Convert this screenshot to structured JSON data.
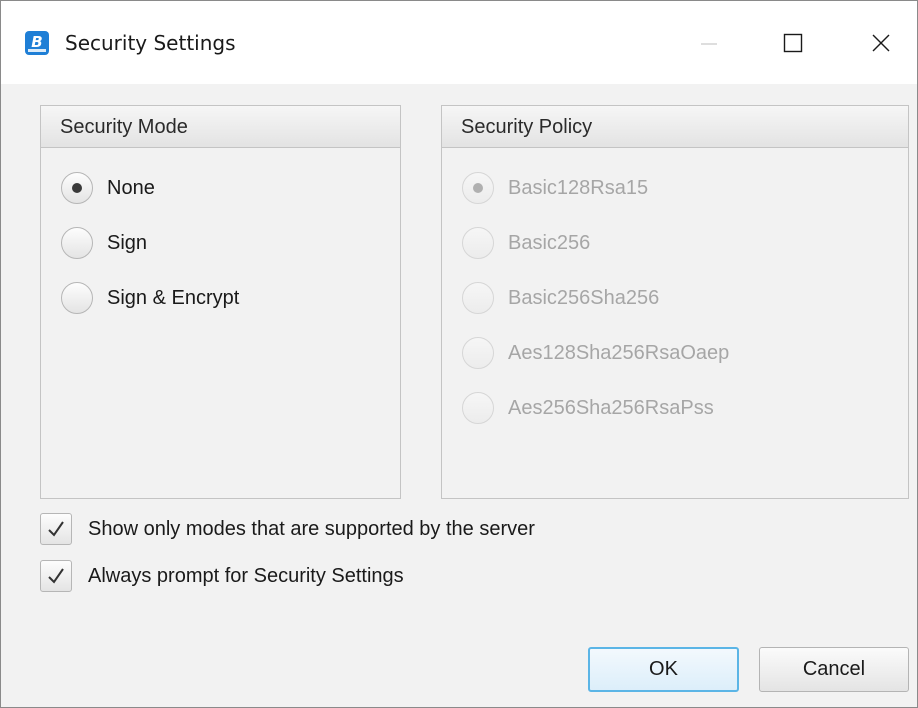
{
  "window": {
    "title": "Security Settings",
    "app_icon_letter": "B",
    "app_icon_color": "#1f7fd6",
    "controls": [
      "minimize-icon",
      "maximize-icon",
      "close-icon"
    ]
  },
  "security_mode": {
    "title": "Security Mode",
    "options": [
      {
        "label": "None",
        "selected": true
      },
      {
        "label": "Sign",
        "selected": false
      },
      {
        "label": "Sign & Encrypt",
        "selected": false
      }
    ]
  },
  "security_policy": {
    "title": "Security Policy",
    "enabled": false,
    "options": [
      {
        "label": "Basic128Rsa15",
        "selected": true
      },
      {
        "label": "Basic256",
        "selected": false
      },
      {
        "label": "Basic256Sha256",
        "selected": false
      },
      {
        "label": "Aes128Sha256RsaOaep",
        "selected": false
      },
      {
        "label": "Aes256Sha256RsaPss",
        "selected": false
      }
    ]
  },
  "checkboxes": [
    {
      "label": "Show only modes that are supported by the server",
      "checked": true
    },
    {
      "label": "Always prompt for Security Settings",
      "checked": true
    }
  ],
  "buttons": {
    "ok_label": "OK",
    "cancel_label": "Cancel"
  },
  "colors": {
    "ok_border": "#5bb5e6",
    "disabled_text": "#a6a6a6"
  }
}
